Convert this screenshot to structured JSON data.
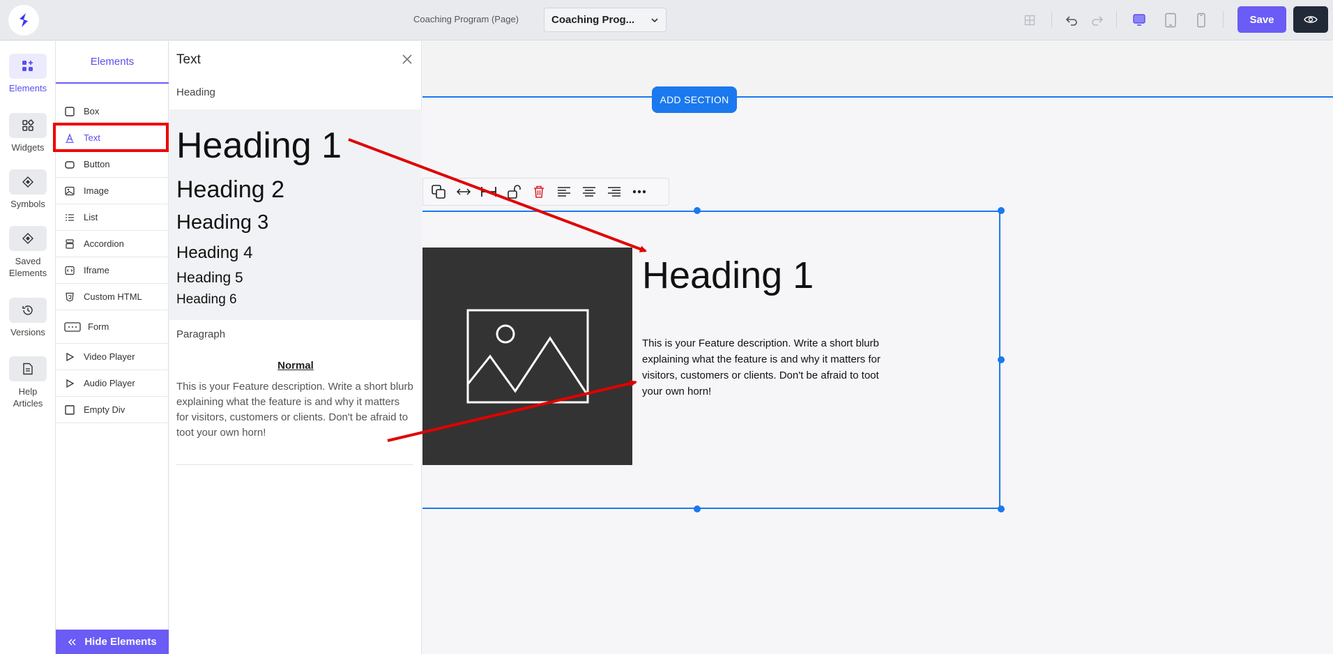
{
  "topbar": {
    "page_label": "Coaching Program (Page)",
    "page_select_value": "Coaching Prog...",
    "save_label": "Save"
  },
  "rail": {
    "items": [
      {
        "label": "Elements",
        "icon": "elements-icon"
      },
      {
        "label": "Widgets",
        "icon": "widgets-icon"
      },
      {
        "label": "Symbols",
        "icon": "symbols-icon"
      },
      {
        "label": "Saved Elements",
        "icon": "saved-elements-icon"
      },
      {
        "label": "Versions",
        "icon": "versions-icon"
      },
      {
        "label": "Help Articles",
        "icon": "help-articles-icon"
      }
    ]
  },
  "elements": {
    "tab_label": "Elements",
    "items": [
      {
        "label": "Box",
        "icon": "box-icon"
      },
      {
        "label": "Text",
        "icon": "text-icon"
      },
      {
        "label": "Button",
        "icon": "button-icon"
      },
      {
        "label": "Image",
        "icon": "image-icon"
      },
      {
        "label": "List",
        "icon": "list-icon"
      },
      {
        "label": "Accordion",
        "icon": "accordion-icon"
      },
      {
        "label": "Iframe",
        "icon": "iframe-icon"
      },
      {
        "label": "Custom HTML",
        "icon": "custom-html-icon"
      },
      {
        "label": "Form",
        "icon": "form-icon"
      },
      {
        "label": "Video Player",
        "icon": "video-player-icon"
      },
      {
        "label": "Audio Player",
        "icon": "audio-player-icon"
      },
      {
        "label": "Empty Div",
        "icon": "empty-div-icon"
      }
    ],
    "hide_label": "Hide Elements"
  },
  "text_panel": {
    "title": "Text",
    "heading_section": "Heading",
    "headings": [
      "Heading 1",
      "Heading 2",
      "Heading 3",
      "Heading 4",
      "Heading 5",
      "Heading 6"
    ],
    "paragraph_section": "Paragraph",
    "normal_label": "Normal",
    "paragraph_text": "This is your Feature description. Write a short blurb explaining what the feature is and why it matters for visitors, customers or clients. Don't be afraid to toot your own horn!"
  },
  "canvas": {
    "add_section_label": "ADD SECTION",
    "heading": "Heading 1",
    "paragraph": "This is your Feature description. Write a short blurb explaining what the feature is and why it matters for visitors, customers or clients. Don't be afraid to toot your own horn!"
  },
  "colors": {
    "accent": "#6a5cf5",
    "selection_blue": "#1a79ee",
    "annotation_red": "#e00000"
  }
}
